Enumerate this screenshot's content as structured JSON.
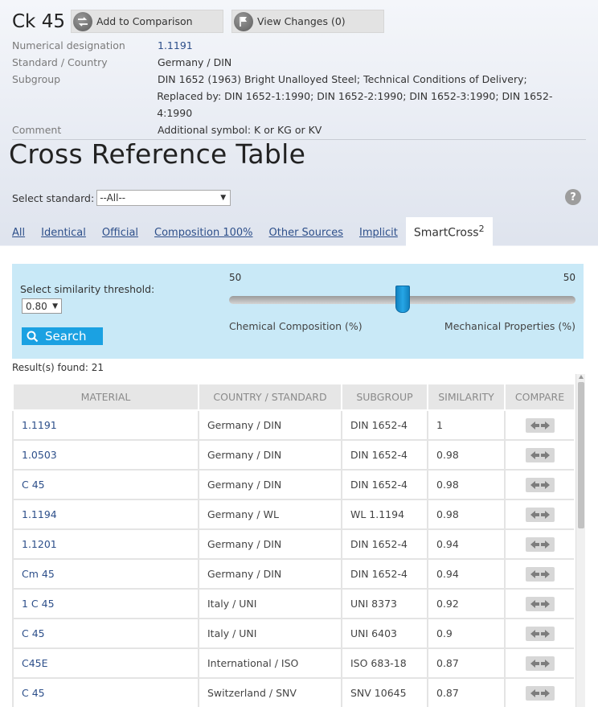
{
  "material": {
    "title": "Ck 45",
    "add_comparison_label": "Add to Comparison",
    "view_changes_label": "View Changes (0)"
  },
  "properties": [
    {
      "label": "Numerical designation",
      "value": "1.1191"
    },
    {
      "label": "Standard / Country",
      "value": "Germany / DIN"
    },
    {
      "label": "Subgroup",
      "value": "DIN 1652 (1963) Bright Unalloyed Steel; Technical Conditions of Delivery;"
    },
    {
      "label": "",
      "value": "Replaced by: DIN 1652-1:1990; DIN 1652-2:1990; DIN 1652-3:1990; DIN 1652-4:1990"
    },
    {
      "label": "Comment",
      "value": "Additional symbol: K or KG or KV"
    }
  ],
  "xref": {
    "title": "Cross Reference Table",
    "select_label": "Select standard:",
    "select_value": "--All--"
  },
  "tabs": [
    "All",
    "Identical",
    "Official",
    "Composition 100%",
    "Other Sources",
    "Implicit"
  ],
  "active_tab": {
    "label": "SmartCross",
    "sup": "2"
  },
  "similarity": {
    "label": "Select similarity threshold:",
    "threshold": "0.80",
    "search_label": "Search",
    "left_value": "50",
    "right_value": "50",
    "left_label": "Chemical Composition (%)",
    "right_label": "Mechanical Properties (%)",
    "slider_fraction": 0.5
  },
  "results_label": "Result(s) found: 21",
  "table": {
    "headers": [
      "MATERIAL",
      "COUNTRY / STANDARD",
      "SUBGROUP",
      "SIMILARITY",
      "COMPARE"
    ],
    "rows": [
      [
        "1.1191",
        "Germany / DIN",
        "DIN 1652-4",
        "1"
      ],
      [
        "1.0503",
        "Germany / DIN",
        "DIN 1652-4",
        "0.98"
      ],
      [
        "C 45",
        "Germany / DIN",
        "DIN 1652-4",
        "0.98"
      ],
      [
        "1.1194",
        "Germany / WL",
        "WL 1.1194",
        "0.98"
      ],
      [
        "1.1201",
        "Germany / DIN",
        "DIN 1652-4",
        "0.94"
      ],
      [
        "Cm 45",
        "Germany / DIN",
        "DIN 1652-4",
        "0.94"
      ],
      [
        "1 C 45",
        "Italy / UNI",
        "UNI 8373",
        "0.92"
      ],
      [
        "C 45",
        "Italy / UNI",
        "UNI 6403",
        "0.9"
      ],
      [
        "C45E",
        "International / ISO",
        "ISO 683-18",
        "0.87"
      ],
      [
        "C 45",
        "Switzerland / SNV",
        "SNV 10645",
        "0.87"
      ]
    ]
  }
}
